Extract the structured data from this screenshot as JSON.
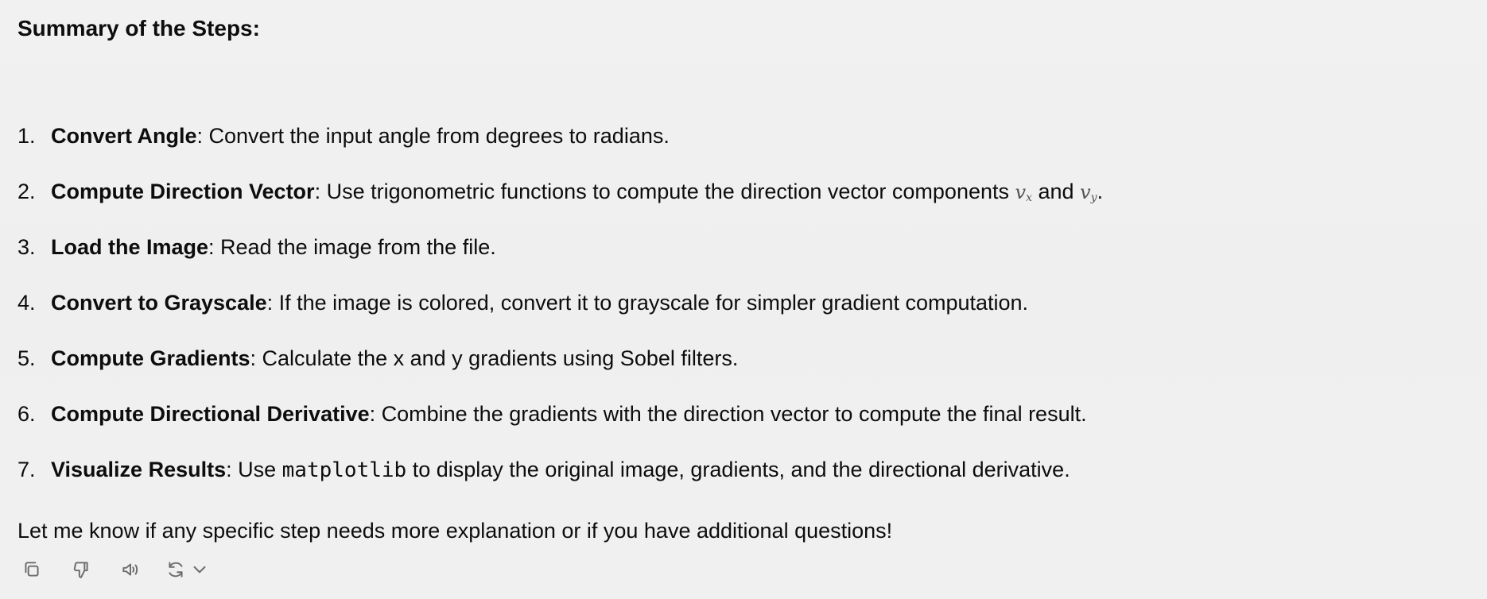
{
  "message": {
    "heading": "Summary of the Steps:",
    "steps": [
      {
        "number": "1.",
        "title": "Convert Angle",
        "text": ": Convert the input angle from degrees to radians."
      },
      {
        "number": "2.",
        "title": "Compute Direction Vector",
        "text": ": Use trigonometric functions to compute the direction vector components",
        "math_vx": "v",
        "math_vx_sub": "x",
        "connector": "and",
        "math_vy": "v",
        "math_vy_sub": "y",
        "end": "."
      },
      {
        "number": "3.",
        "title": "Load the Image",
        "text": ": Read the image from the file."
      },
      {
        "number": "4.",
        "title": "Convert to Grayscale",
        "text": ": If the image is colored, convert it to grayscale for simpler gradient computation."
      },
      {
        "number": "5.",
        "title": "Compute Gradients",
        "text": ": Calculate the x and y gradients using Sobel filters."
      },
      {
        "number": "6.",
        "title": "Compute Directional Derivative",
        "text": ": Combine the gradients with the direction vector to compute the final result."
      },
      {
        "number": "7.",
        "title": "Visualize Results",
        "text_before": ": Use",
        "code": "matplotlib",
        "text_after": "to display the original image, gradients, and the directional derivative."
      }
    ],
    "closing": "Let me know if any specific step needs more explanation or if you have additional questions!"
  },
  "actions": {
    "icons": [
      "copy-icon",
      "thumbs-down-icon",
      "read-aloud-icon",
      "regenerate-icon",
      "chevron-down-icon"
    ]
  }
}
